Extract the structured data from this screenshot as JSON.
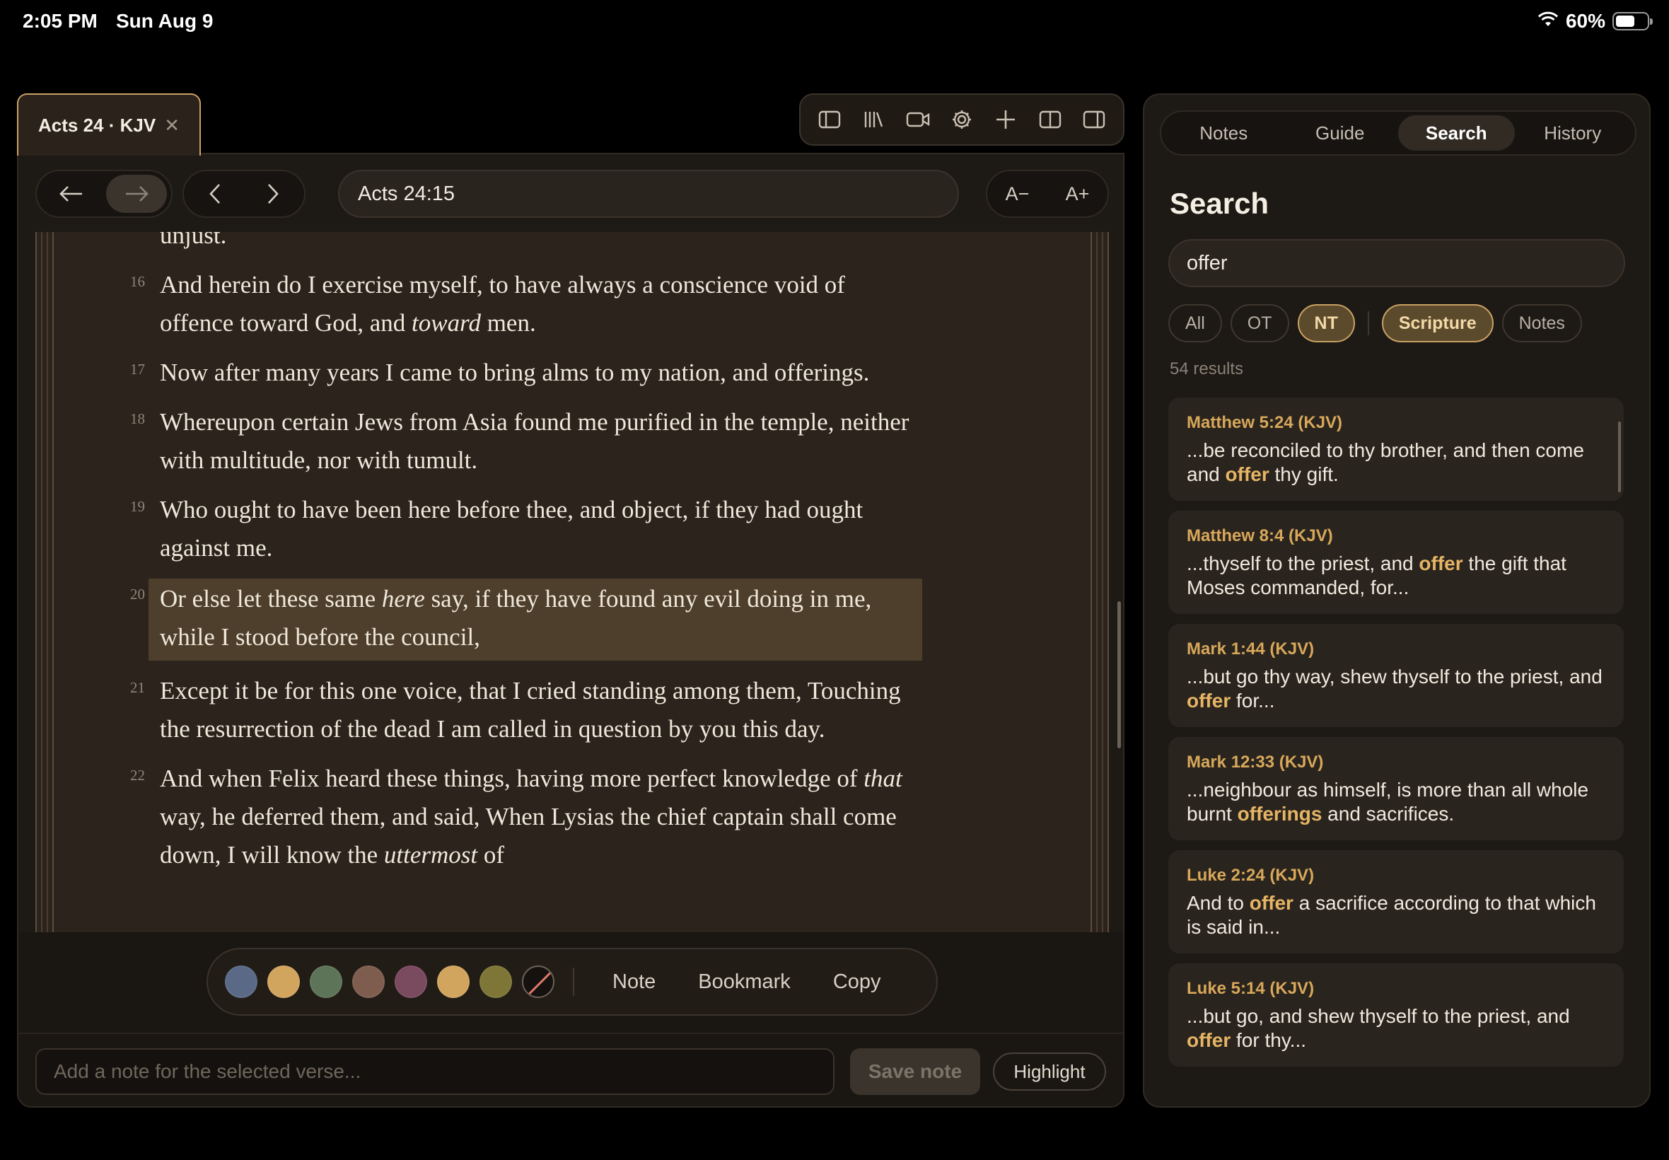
{
  "status": {
    "time": "2:05 PM",
    "date": "Sun Aug 9",
    "battery": "60%"
  },
  "tab": {
    "title": "Acts 24 · KJV"
  },
  "reader": {
    "reference": "Acts 24:15",
    "font_decrease": "A−",
    "font_increase": "A+",
    "verses": [
      {
        "num": "",
        "html": "unjust."
      },
      {
        "num": "16",
        "html": "And herein do I exercise myself, to have always a conscience void of offence toward God, and <i>toward</i> men."
      },
      {
        "num": "17",
        "html": "Now after many years I came to bring alms to my nation, and offerings."
      },
      {
        "num": "18",
        "html": "Whereupon certain Jews from Asia found me purified in the temple, neither with multitude, nor with tumult."
      },
      {
        "num": "19",
        "html": "Who ought to have been here before thee, and object, if they had ought against me."
      },
      {
        "num": "20",
        "html": "Or else let these same <i>here</i> say, if they have found any evil doing in me, while I stood before the council,",
        "highlight": true
      },
      {
        "num": "21",
        "html": "Except it be for this one voice, that I cried standing among them, Touching the resurrection of the dead I am called in question by you this day."
      },
      {
        "num": "22",
        "html": "And when Felix heard these things, having more perfect knowledge of <i>that</i> way, he deferred them, and said, When Lysias the chief captain shall come down, I will know the <i>uttermost</i> of"
      }
    ]
  },
  "actions": {
    "swatches": [
      "#5a6a86",
      "#d2a55e",
      "#5d7458",
      "#7e5d4e",
      "#7a4a5e",
      "#d2a55e",
      "#7d7636"
    ],
    "note": "Note",
    "bookmark": "Bookmark",
    "copy": "Copy"
  },
  "notebar": {
    "placeholder": "Add a note for the selected verse...",
    "save": "Save note",
    "highlight": "Highlight"
  },
  "sidebar": {
    "tabs": [
      "Notes",
      "Guide",
      "Search",
      "History"
    ],
    "active_tab": "Search",
    "heading": "Search",
    "query": "offer",
    "filters": {
      "all": "All",
      "ot": "OT",
      "nt": "NT",
      "scripture": "Scripture",
      "notes": "Notes"
    },
    "count": "54 results",
    "results": [
      {
        "ref": "Matthew 5:24 (KJV)",
        "html": "...be reconciled to thy brother, and then come and <b>offer</b> thy gift."
      },
      {
        "ref": "Matthew 8:4 (KJV)",
        "html": "...thyself to the priest, and <b>offer</b> the gift that Moses commanded, for..."
      },
      {
        "ref": "Mark 1:44 (KJV)",
        "html": "...but go thy way, shew thyself to the priest, and <b>offer</b> for..."
      },
      {
        "ref": "Mark 12:33 (KJV)",
        "html": "...neighbour as himself, is more than all whole burnt <b>offerings</b> and sacrifices."
      },
      {
        "ref": "Luke 2:24 (KJV)",
        "html": "And to <b>offer</b> a sacrifice according to that which is said in..."
      },
      {
        "ref": "Luke 5:14 (KJV)",
        "html": "...but go, and shew thyself to the priest, and <b>offer</b> for thy..."
      }
    ]
  }
}
